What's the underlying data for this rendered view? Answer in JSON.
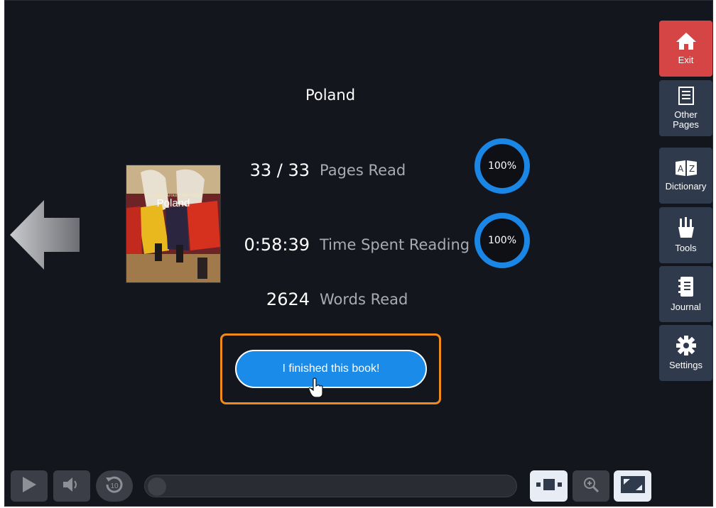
{
  "book": {
    "title": "Poland",
    "cover_series": "Countries Around the World",
    "cover_title": "Poland"
  },
  "stats": [
    {
      "value": "33 / 33",
      "label": "Pages Read",
      "percent_text": "100%",
      "percent": 100
    },
    {
      "value": "0:58:39",
      "label": "Time Spent Reading",
      "percent_text": "100%",
      "percent": 100
    },
    {
      "value": "2624",
      "label": "Words Read"
    }
  ],
  "finish_button": {
    "label": "I finished this book!"
  },
  "sidebar": {
    "items": [
      {
        "label": "Exit",
        "icon": "home-icon"
      },
      {
        "label": "Other Pages",
        "icon": "list-icon"
      },
      {
        "label": "Dictionary",
        "icon": "dictionary-icon"
      },
      {
        "label": "Tools",
        "icon": "tools-icon"
      },
      {
        "label": "Journal",
        "icon": "journal-icon"
      },
      {
        "label": "Settings",
        "icon": "gear-icon"
      }
    ]
  },
  "player": {
    "replay_seconds": "10",
    "progress": 0
  },
  "colors": {
    "background": "#14161d",
    "accent": "#1a86e5",
    "exit": "#d64545",
    "highlight": "#f08a1e",
    "sidebar": "#2f3a4d"
  }
}
